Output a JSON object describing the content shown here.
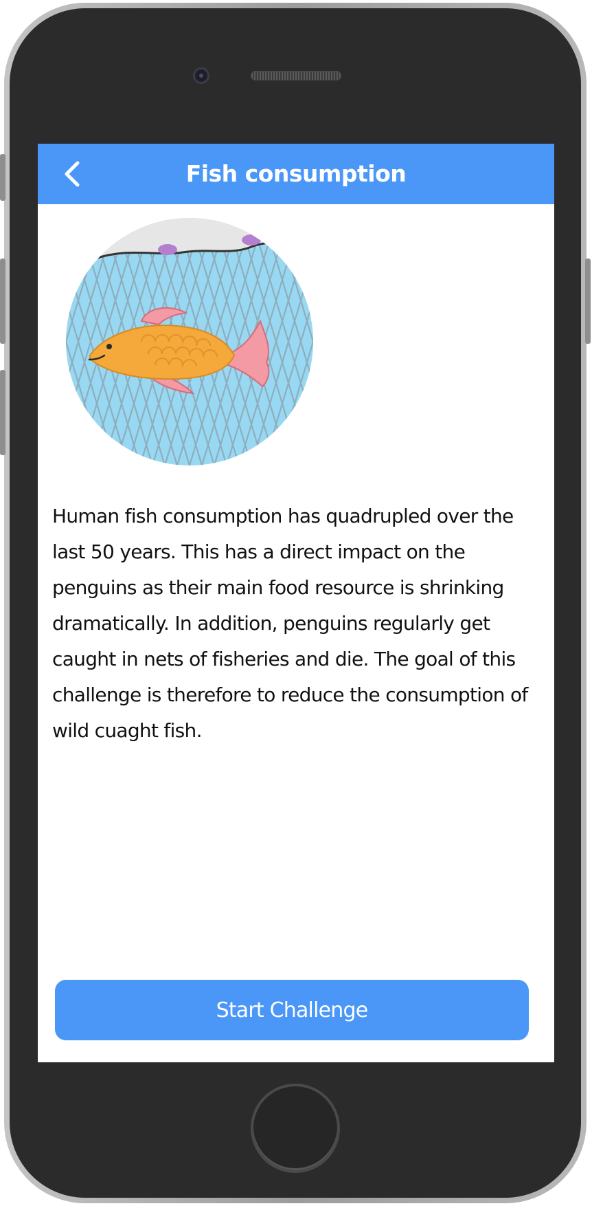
{
  "nav": {
    "title": "Fish consumption",
    "back_icon": "chevron-left-icon"
  },
  "hero_image": {
    "icon": "fish-in-net-illustration"
  },
  "description": "Human fish consumption has quadrupled over the last 50 years. This has a direct impact on the penguins as their main food resource is shrinking dramatically. In addition, penguins regularly get caught in nets of fisheries and die. The goal of this challenge is therefore to reduce the consumption of wild cuaght fish.",
  "actions": {
    "start_label": "Start Challenge"
  },
  "colors": {
    "accent": "#4a97f8",
    "background": "#ffffff",
    "text": "#111111",
    "device_frame": "#2b2b2b"
  }
}
